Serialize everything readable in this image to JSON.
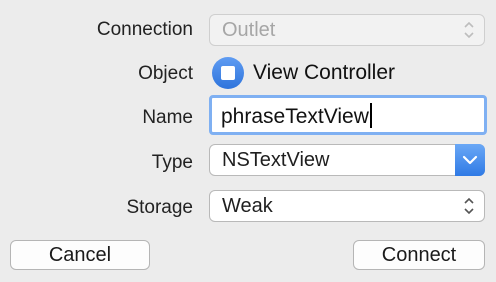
{
  "labels": {
    "connection": "Connection",
    "object": "Object",
    "name": "Name",
    "type": "Type",
    "storage": "Storage"
  },
  "connection": {
    "value": "Outlet",
    "enabled": false
  },
  "object": {
    "value": "View Controller",
    "icon": "view-controller-icon"
  },
  "name_field": {
    "value": "phraseTextView"
  },
  "type_field": {
    "value": "NSTextView"
  },
  "storage": {
    "value": "Weak"
  },
  "buttons": {
    "cancel": "Cancel",
    "connect": "Connect"
  },
  "colors": {
    "accent": "#2f7ae5",
    "focus_ring": "#7fb0f2",
    "background": "#ececec"
  }
}
